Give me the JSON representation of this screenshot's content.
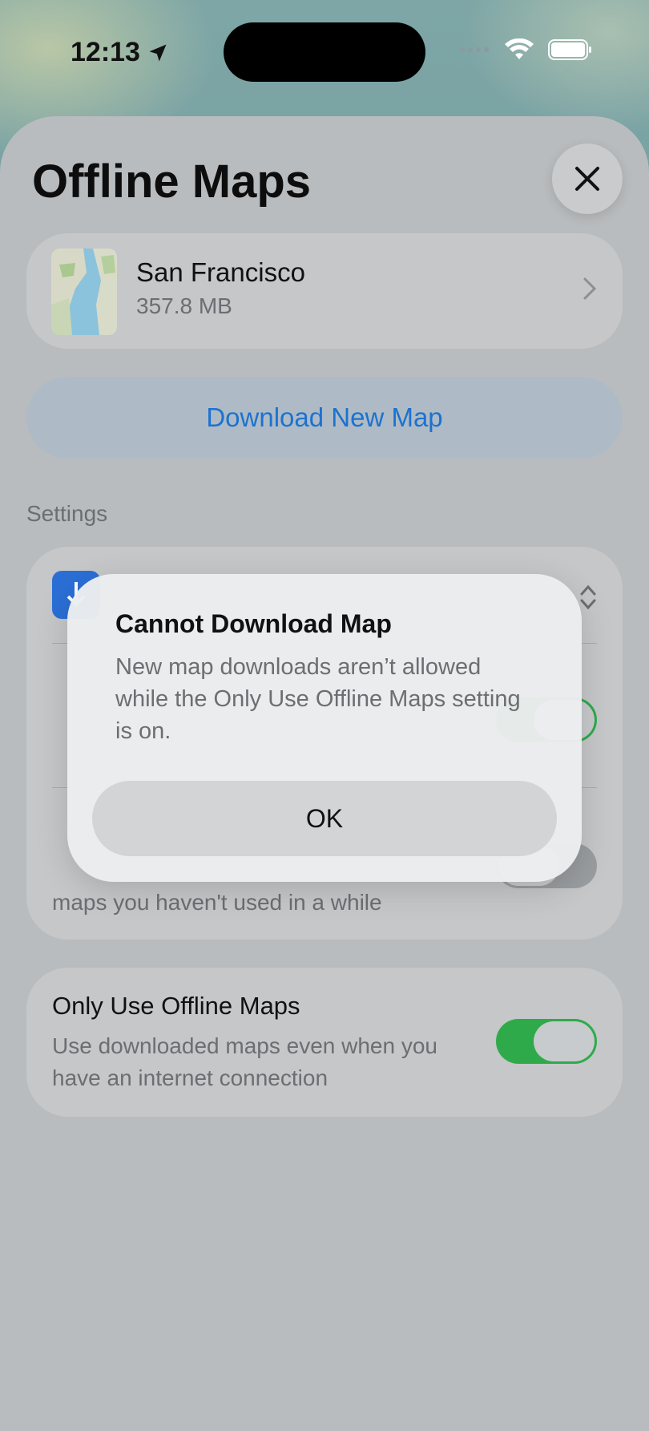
{
  "status_bar": {
    "time": "12:13"
  },
  "sheet": {
    "title": "Offline Maps",
    "map": {
      "name": "San Francisco",
      "size": "357.8 MB"
    },
    "download_button": "Download New Map",
    "settings_label": "Settings",
    "settings": {
      "optimize": {
        "subtitle": "maps you haven't used in a while"
      }
    },
    "only_offline": {
      "title": "Only Use Offline Maps",
      "subtitle_line1": "Use downloaded maps even when you",
      "subtitle_line2": "have an internet connection"
    }
  },
  "alert": {
    "title": "Cannot Download Map",
    "message": "New map downloads aren’t allowed while the Only Use Offline Maps setting is on.",
    "ok": "OK"
  },
  "colors": {
    "accent": "#1d72cf",
    "toggle_on": "#2faa4a"
  }
}
